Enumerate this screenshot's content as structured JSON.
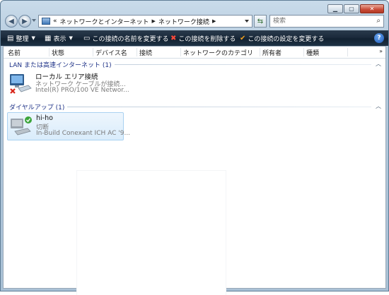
{
  "address": {
    "overflow": "«",
    "crumbs": [
      "ネットワークとインターネット",
      "ネットワーク接続"
    ]
  },
  "search": {
    "placeholder": "検索"
  },
  "toolbar": {
    "organize": "整理",
    "views": "表示",
    "rename": "この接続の名前を変更する",
    "delete": "この接続を削除する",
    "change_settings": "この接続の設定を変更する"
  },
  "columns": [
    "名前",
    "状態",
    "デバイス名",
    "接続",
    "ネットワークのカテゴリ",
    "所有者",
    "種類"
  ],
  "groups": [
    {
      "title": "LAN または高速インターネット (1)",
      "items": [
        {
          "name": "ローカル エリア接続",
          "status": "ネットワーク ケーブルが接続...",
          "device": "Intel(R) PRO/100 VE Networ..."
        }
      ]
    },
    {
      "title": "ダイヤルアップ (1)",
      "items": [
        {
          "name": "hi-ho",
          "status": "切断",
          "device": "In-Build Conexant ICH AC '9..."
        }
      ]
    }
  ],
  "colors": {
    "toolbar": "#1b2a3b",
    "group_title": "#1e3287",
    "selection": "#d9ecfb",
    "delete_icon": "#d8261a",
    "settings_icon": "#f0a020"
  }
}
